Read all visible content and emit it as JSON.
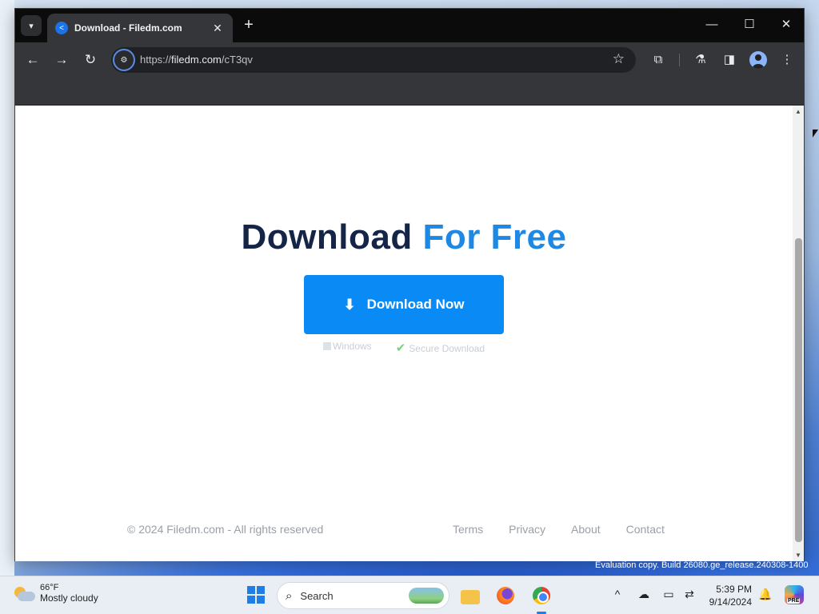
{
  "desktop": {
    "watermark": "Evaluation copy. Build 26080.ge_release.240308-1400"
  },
  "browser": {
    "tab": {
      "title": "Download - Filedm.com",
      "close_glyph": "✕",
      "favicon_icon": "share-icon"
    },
    "new_tab_glyph": "+",
    "window_controls": {
      "minimize": "—",
      "maximize": "☐",
      "close": "✕"
    },
    "toolbar": {
      "back": "←",
      "forward": "→",
      "reload": "↻",
      "url_prefix": "https://",
      "url_host": "filedm.com",
      "url_path": "/cT3qv",
      "bookmark_star": "☆",
      "extensions": "⧉",
      "labs": "⚗",
      "side_panel": "◨",
      "menu": "⋮"
    }
  },
  "page": {
    "hero_dark": "Download",
    "hero_blue": "For Free",
    "download_button": "Download Now",
    "download_icon": "⬇",
    "meta_windows": "Windows",
    "meta_secure": "Secure Download",
    "footer": {
      "copyright": "© 2024 Filedm.com - All rights reserved",
      "links": [
        "Terms",
        "Privacy",
        "About",
        "Contact"
      ]
    }
  },
  "taskbar": {
    "weather_temp": "66°F",
    "weather_desc": "Mostly cloudy",
    "search_placeholder": "Search",
    "search_icon": "⌕",
    "tray": {
      "chevron": "^",
      "onedrive": "☁",
      "display": "▭",
      "network": "⇄"
    },
    "time": "5:39 PM",
    "date": "9/14/2024",
    "bell": "🔔",
    "copilot_badge": "PRE"
  },
  "colors": {
    "hero_dark": "#142547",
    "hero_blue": "#1e88e5",
    "button": "#0a8af5",
    "chrome_bg": "#35363a"
  }
}
